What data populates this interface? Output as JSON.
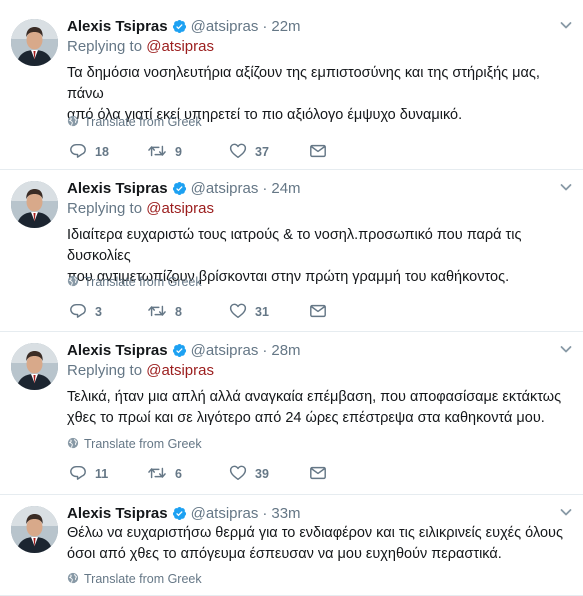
{
  "tweets": [
    {
      "name": "Alexis Tsipras",
      "handle": "@atsipras",
      "separator": "·",
      "time": "22m",
      "replying_prefix": "Replying to",
      "replying_to": "@atsipras",
      "lines": [
        "Τα δημόσια νοσηλευτήρια αξίζουν της εμπιστοσύνης και της στήριξής μας, πάνω",
        "από όλα γιατί εκεί υπηρετεί το πιο αξιόλογο έμψυχο δυναμικό."
      ],
      "translate": "Translate from Greek",
      "replies": "18",
      "retweets": "9",
      "likes": "37"
    },
    {
      "name": "Alexis Tsipras",
      "handle": "@atsipras",
      "separator": "·",
      "time": "24m",
      "replying_prefix": "Replying to",
      "replying_to": "@atsipras",
      "lines": [
        "Ιδιαίτερα ευχαριστώ τους ιατρούς & το νοσηλ.προσωπικό που παρά τις δυσκολίες",
        "που αντιμετωπίζουν βρίσκονται στην πρώτη γραμμή του καθήκοντος."
      ],
      "translate": "Translate from Greek",
      "replies": "3",
      "retweets": "8",
      "likes": "31"
    },
    {
      "name": "Alexis Tsipras",
      "handle": "@atsipras",
      "separator": "·",
      "time": "28m",
      "replying_prefix": "Replying to",
      "replying_to": "@atsipras",
      "lines": [
        "Τελικά, ήταν μια απλή αλλά αναγκαία επέμβαση, που αποφασίσαμε εκτάκτως",
        "χθες το πρωί και σε λιγότερο από 24 ώρες επέστρεψα στα καθηκοντά μου."
      ],
      "translate": "Translate from Greek",
      "replies": "11",
      "retweets": "6",
      "likes": "39"
    },
    {
      "name": "Alexis Tsipras",
      "handle": "@atsipras",
      "separator": "·",
      "time": "33m",
      "replying_prefix": "",
      "replying_to": "",
      "lines": [
        "Θέλω να ευχαριστήσω θερμά για το ενδιαφέρον και τις ειλικρινείς ευχές όλους",
        "όσοι από χθες το απόγευμα έσπευσαν να μου ευχηθούν περαστικά."
      ],
      "translate": "Translate from Greek",
      "replies": "",
      "retweets": "",
      "likes": ""
    }
  ],
  "colors": {
    "verified": "#1da1f2",
    "reply_link": "#9b1d1d",
    "muted": "#657786",
    "divider": "#e6ecf0"
  },
  "icons": {
    "verified": "verified-badge-icon",
    "caret": "chevron-down-icon",
    "globe": "globe-icon",
    "reply": "reply-icon",
    "retweet": "retweet-icon",
    "like": "heart-icon",
    "dm": "envelope-icon"
  }
}
